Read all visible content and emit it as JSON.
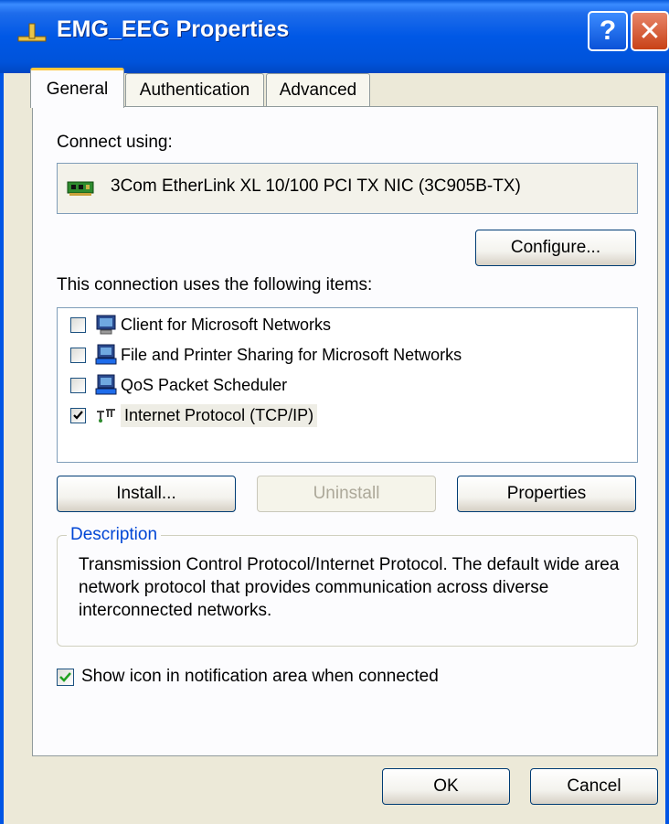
{
  "window": {
    "title": "EMG_EEG Properties",
    "help_label": "?",
    "close_label": "✕"
  },
  "tabs": [
    {
      "label": "General"
    },
    {
      "label": "Authentication"
    },
    {
      "label": "Advanced"
    }
  ],
  "connect_using": {
    "label": "Connect using:",
    "adapter": "3Com EtherLink XL 10/100 PCI TX NIC (3C905B-TX)"
  },
  "configure_label": "Configure...",
  "items_label": "This connection uses the following items:",
  "items": [
    {
      "label": "Client for Microsoft Networks",
      "checked": false,
      "icon": "network-client-icon"
    },
    {
      "label": "File and Printer Sharing for Microsoft Networks",
      "checked": false,
      "icon": "network-service-icon"
    },
    {
      "label": "QoS Packet Scheduler",
      "checked": false,
      "icon": "network-service-icon"
    },
    {
      "label": "Internet Protocol (TCP/IP)",
      "checked": true,
      "selected": true,
      "icon": "protocol-icon"
    }
  ],
  "buttons": {
    "install": "Install...",
    "uninstall": "Uninstall",
    "properties": "Properties",
    "ok": "OK",
    "cancel": "Cancel"
  },
  "description": {
    "legend": "Description",
    "text": "Transmission Control Protocol/Internet Protocol. The default wide area network protocol that provides communication across diverse interconnected networks."
  },
  "show_icon": {
    "label": "Show icon in notification area when connected",
    "checked": true
  }
}
